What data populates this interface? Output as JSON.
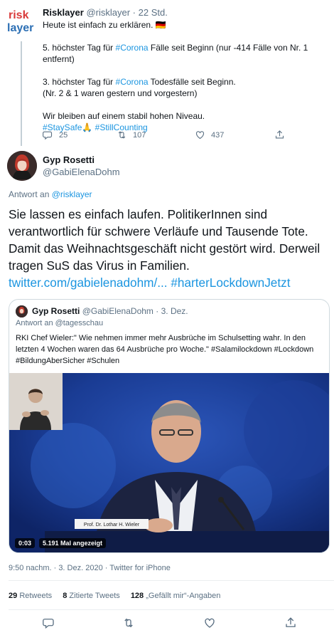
{
  "parent_tweet": {
    "logo_text_top": "risk",
    "logo_text_bottom": "layer",
    "author_name": "Risklayer",
    "author_handle": "@risklayer",
    "separator": "·",
    "time_ago": "22 Std.",
    "line1": "Heute ist einfach zu erklären. 🇩🇪",
    "line2_pre": "5. höchster Tag für ",
    "line2_tag": "#Corona",
    "line2_post": " Fälle seit Beginn (nur -414 Fälle von Nr. 1 entfernt)",
    "line3_pre": "3. höchster Tag für ",
    "line3_tag": "#Corona",
    "line3_post": " Todesfälle seit Beginn.",
    "line4": "(Nr. 2 & 1 waren gestern und vorgestern)",
    "line5": "Wir bleiben auf einem stabil hohen Niveau.",
    "tag_staysafe": "#StaySafe",
    "emoji_hand": "🙏",
    "tag_stillcounting": "#StillCounting",
    "replies": "25",
    "retweets": "107",
    "likes": "437"
  },
  "main_tweet": {
    "author_name": "Gyp Rosetti",
    "author_handle": "@GabiElenaDohm",
    "reply_to_prefix": "Antwort an ",
    "reply_to_handle": "@risklayer",
    "text_body": "Sie lassen es einfach laufen. PolitikerInnen sind verantwortlich für schwere Verläufe und Tausende Tote. Damit das Weihnachtsgeschäft nicht gestört wird. Derweil tragen SuS das Virus in Familien.",
    "link": "twitter.com/gabielenadohm/...",
    "hashtag": "#harterLockdownJetzt",
    "timestamp": "9:50 nachm. · 3. Dez. 2020 · Twitter for iPhone",
    "retweets_count": "29",
    "retweets_label": "Retweets",
    "quotes_count": "8",
    "quotes_label": "Zitierte Tweets",
    "likes_count": "128",
    "likes_label": "„Gefällt mir“-Angaben"
  },
  "quoted_tweet": {
    "author_name": "Gyp Rosetti",
    "author_handle": "@GabiElenaDohm",
    "separator": "·",
    "date": "3. Dez.",
    "reply_to_prefix": "Antwort an ",
    "reply_to_handle": "@tagesschau",
    "text": "RKI Chef Wieler:\" Wie nehmen immer mehr Ausbrüche im Schulsetting wahr. In den letzten 4 Wochen waren das 64 Ausbrüche pro Woche.\" #Salamilockdown #Lockdown #BildungAberSicher #Schulen",
    "video_time": "0:03",
    "video_views": "5.191 Mal angezeigt",
    "nameplate": "Prof. Dr. Lothar H. Wieler"
  },
  "colors": {
    "link": "#1b95e0",
    "muted": "#5b7083",
    "video_bg": "#16357e"
  },
  "icons": [
    "reply-icon",
    "retweet-icon",
    "like-icon",
    "share-icon",
    "german-flag-emoji",
    "pray-emoji"
  ]
}
